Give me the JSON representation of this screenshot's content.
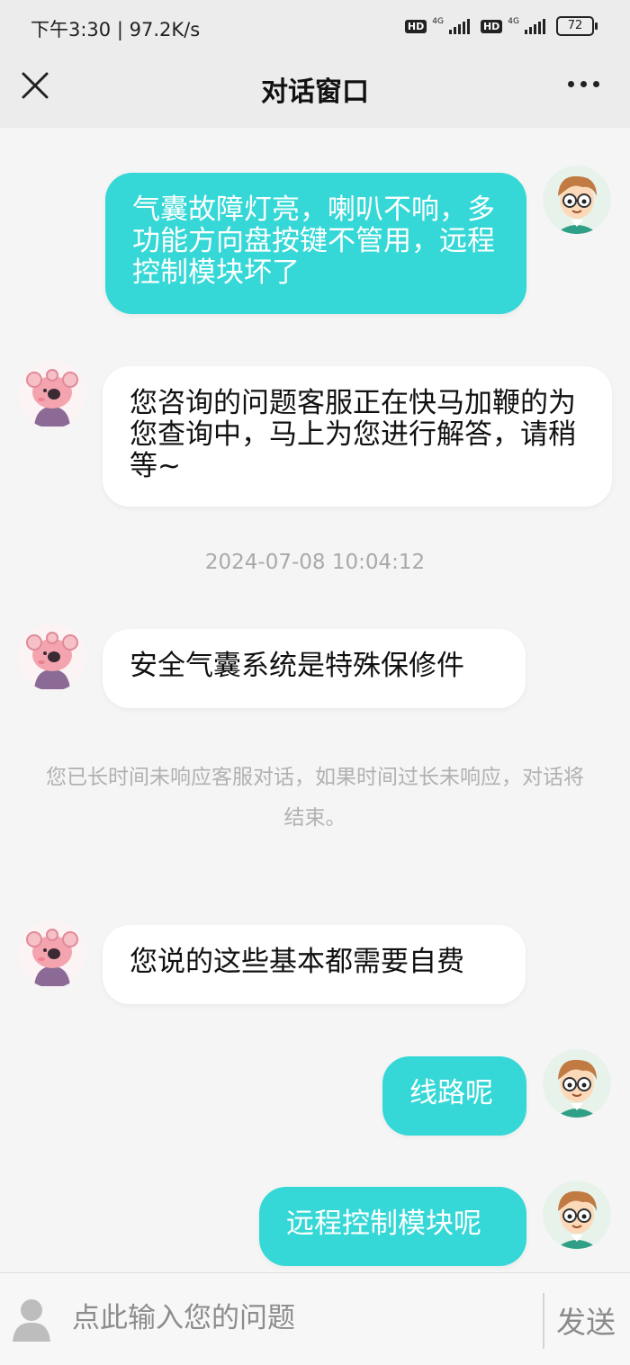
{
  "status_bar": {
    "time": "下午3:30",
    "speed": "97.2K/s",
    "hd1": "HD",
    "net1": "4G",
    "hd2": "HD",
    "net2": "4G",
    "battery": "72"
  },
  "header": {
    "title": "对话窗口",
    "close_icon": "close-icon",
    "more_icon": "more-icon"
  },
  "messages": [
    {
      "sender": "user",
      "text": "气囊故障灯亮，喇叭不响，多功能方向盘按键不管用，远程控制模块坏了"
    },
    {
      "sender": "agent",
      "text": "您咨询的问题客服正在快马加鞭的为您查询中，马上为您进行解答，请稍等~"
    },
    {
      "sender": "agent",
      "text": "安全气囊系统是特殊保修件"
    },
    {
      "sender": "agent",
      "text": "您说的这些基本都需要自费"
    },
    {
      "sender": "user",
      "text": "线路呢"
    },
    {
      "sender": "user",
      "text": "远程控制模块呢"
    }
  ],
  "timestamp": "2024-07-08 10:04:12",
  "timeout_notice": "您已长时间未响应客服对话，如果时间过长未响应，对话将结束。",
  "input_bar": {
    "placeholder": "点此输入您的问题",
    "value": "",
    "send_label": "发送"
  },
  "colors": {
    "user_bubble": "#35d8d6",
    "agent_bubble": "#ffffff",
    "background": "#f5f5f5",
    "header_bg": "#ececec"
  }
}
